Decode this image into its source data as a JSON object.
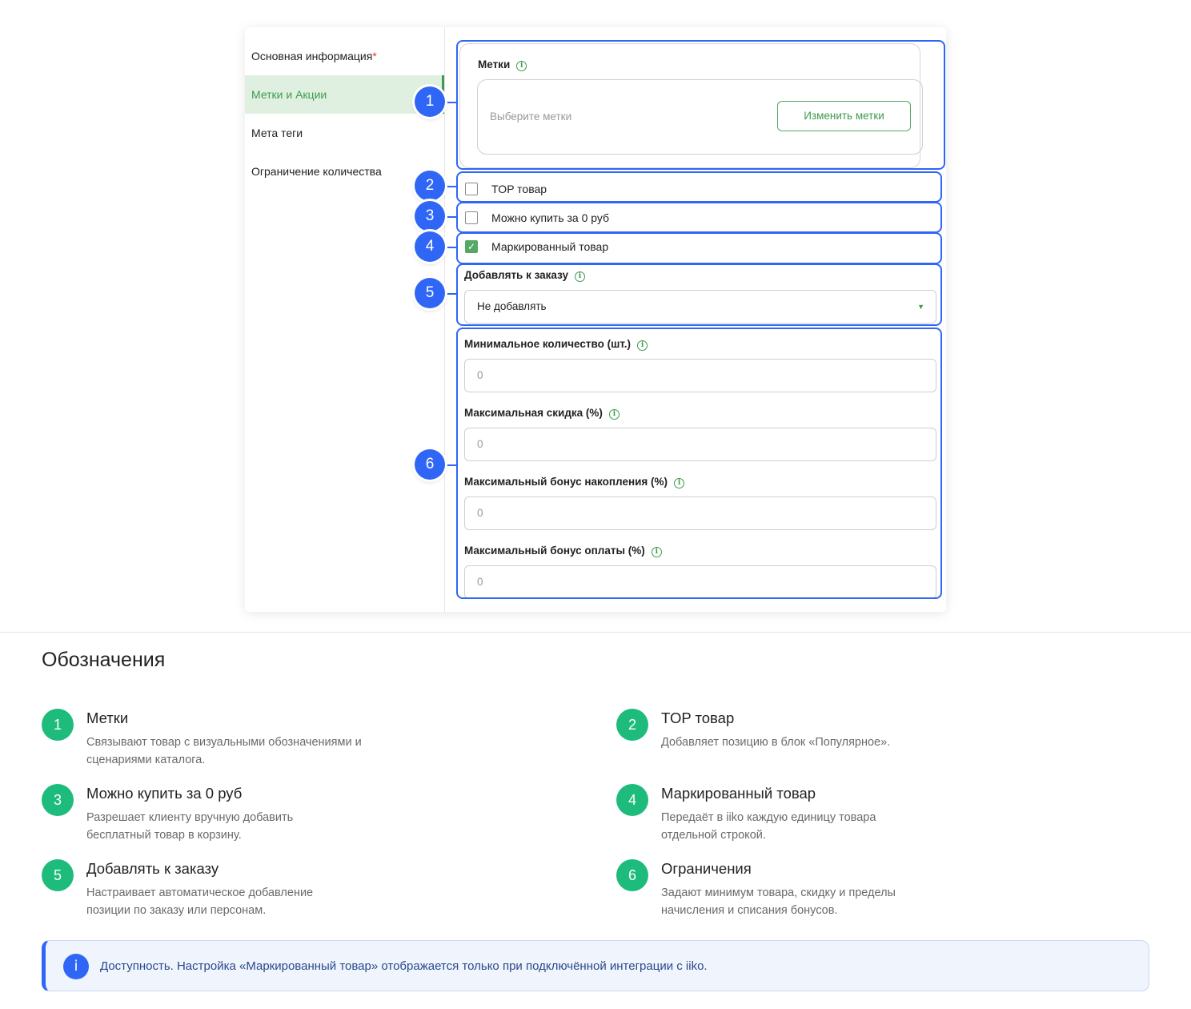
{
  "sidebar": {
    "items": [
      {
        "label": "Основная информация",
        "required_mark": "*"
      },
      {
        "label": "Метки и Акции"
      },
      {
        "label": "Мета теги"
      },
      {
        "label": "Ограничение количества"
      }
    ]
  },
  "form": {
    "tags": {
      "label": "Метки",
      "placeholder": "Выберите метки",
      "button": "Изменить метки"
    },
    "top_item": {
      "label": "TOP товар",
      "checked": false
    },
    "free_buy": {
      "label": "Можно купить за 0 руб",
      "checked": false
    },
    "marked": {
      "label": "Маркированный товар",
      "checked": true
    },
    "add_to_order": {
      "label": "Добавлять к заказу",
      "value": "Не добавлять"
    },
    "min_qty": {
      "label": "Минимальное количество (шт.)",
      "value": "0"
    },
    "max_discount": {
      "label": "Максимальная скидка (%)",
      "value": "0"
    },
    "max_bonus_accrual": {
      "label": "Максимальный бонус накопления (%)",
      "value": "0"
    },
    "max_bonus_payment": {
      "label": "Максимальный бонус оплаты (%)",
      "value": "0"
    }
  },
  "badges": [
    "1",
    "2",
    "3",
    "4",
    "5",
    "6"
  ],
  "legend": {
    "title": "Обозначения",
    "items": [
      {
        "num": "1",
        "title": "Метки",
        "desc": "Связывают товар с визуальными обозначениями и сценариями каталога."
      },
      {
        "num": "2",
        "title": "TOP товар",
        "desc": "Добавляет позицию в блок «Популярное»."
      },
      {
        "num": "3",
        "title": "Можно купить за 0 руб",
        "desc": "Разрешает клиенту вручную добавить бесплатный товар в корзину."
      },
      {
        "num": "4",
        "title": "Маркированный товар",
        "desc": "Передаёт в iiko каждую единицу товара отдельной строкой."
      },
      {
        "num": "5",
        "title": "Добавлять к заказу",
        "desc": "Настраивает автоматическое добавление позиции по заказу или персонам."
      },
      {
        "num": "6",
        "title": "Ограничения",
        "desc": "Задают минимум товара, скидку и пределы начисления и списания бонусов."
      }
    ]
  },
  "note": {
    "icon": "info-icon",
    "text": "Доступность. Настройка «Маркированный товар» отображается только при подключённой интеграции с iiko."
  },
  "colors": {
    "accent_green": "#3e9a4d",
    "highlight_blue": "#2f66f5",
    "legend_green": "#1ebc7c"
  }
}
